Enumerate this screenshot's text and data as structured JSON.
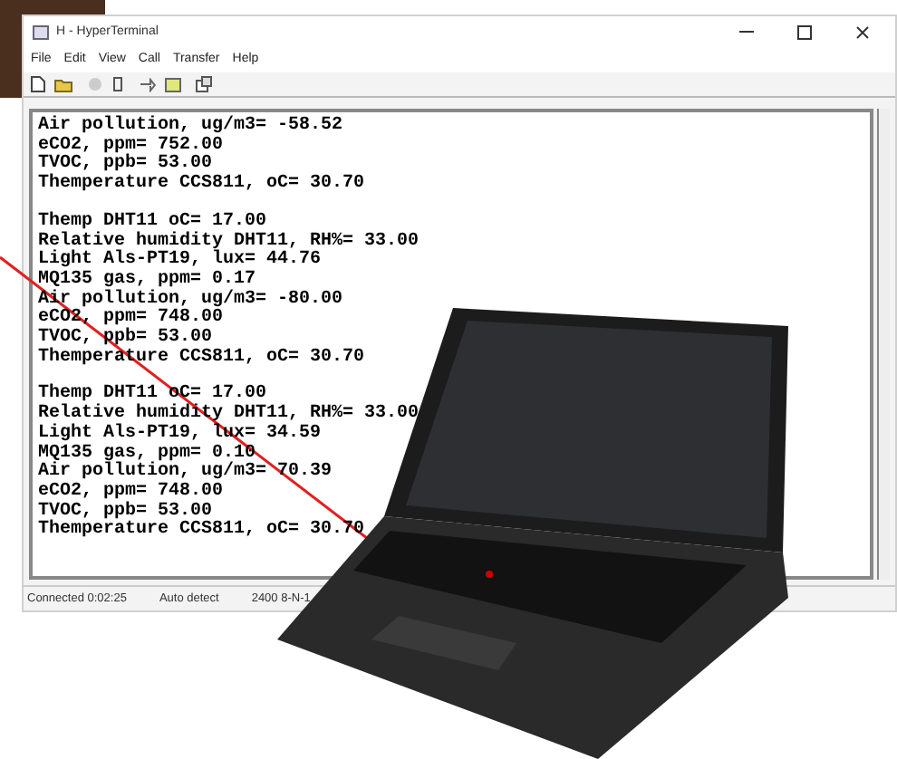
{
  "window": {
    "title": "H - HyperTerminal"
  },
  "menu": [
    "File",
    "Edit",
    "View",
    "Call",
    "Transfer",
    "Help"
  ],
  "terminal": {
    "blocks": [
      [
        "Air pollution, ug/m3= -58.52",
        "eCO2, ppm= 752.00",
        "TVOC, ppb= 53.00",
        "Themperature CCS811, oC= 30.70"
      ],
      [
        "Themp DHT11 oC= 17.00",
        "Relative humidity DHT11, RH%= 33.00",
        "Light Als-PT19, lux= 44.76",
        "MQ135 gas, ppm= 0.17",
        "Air pollution, ug/m3= -80.00",
        "eCO2, ppm= 748.00",
        "TVOC, ppb= 53.00",
        "Themperature CCS811, oC= 30.70"
      ],
      [
        "Themp DHT11 oC= 17.00",
        "Relative humidity DHT11, RH%= 33.00",
        "Light Als-PT19, lux= 34.59",
        "MQ135 gas, ppm= 0.10",
        "Air pollution, ug/m3= 70.39",
        "eCO2, ppm= 748.00",
        "TVOC, ppb= 53.00",
        "Themperature CCS811, oC= 30.70"
      ]
    ]
  },
  "status_bar": [
    "Connected 0:02:25",
    "Auto detect",
    "2400 8-N-1"
  ]
}
